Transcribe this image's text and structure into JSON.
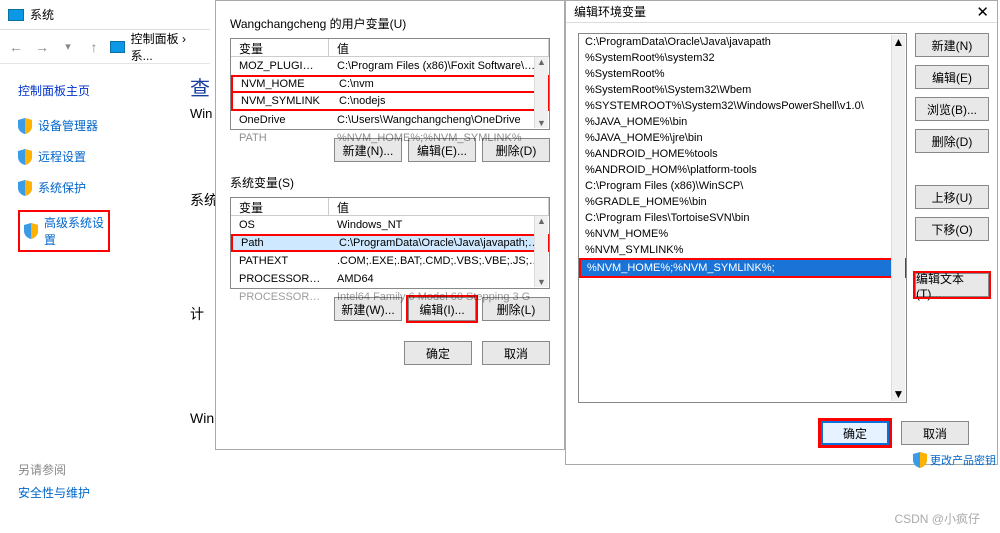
{
  "system_window": {
    "title": "系统",
    "breadcrumbs": [
      "控制面板",
      "系..."
    ],
    "cp_home": "控制面板主页",
    "side_items": [
      "设备管理器",
      "远程设置",
      "系统保护",
      "高级系统设置"
    ],
    "see_also_label": "另请参阅",
    "see_also_items": [
      "安全性与维护"
    ]
  },
  "mid": {
    "cha": "查",
    "win1": "Win",
    "sys": "系统",
    "ji": "计",
    "win2": "Win"
  },
  "env_dialog": {
    "user_vars_label": "Wangchangcheng 的用户变量(U)",
    "system_vars_label": "系统变量(S)",
    "headers": {
      "var": "变量",
      "val": "值"
    },
    "user_vars": [
      {
        "name": "MOZ_PLUGIN_PA...",
        "value": "C:\\Program Files (x86)\\Foxit Software\\Fo..."
      },
      {
        "name": "NVM_HOME",
        "value": "C:\\nvm"
      },
      {
        "name": "NVM_SYMLINK",
        "value": "C:\\nodejs"
      },
      {
        "name": "OneDrive",
        "value": "C:\\Users\\Wangchangcheng\\OneDrive"
      },
      {
        "name": "PATH",
        "value": "%NVM_HOME%;%NVM_SYMLINK%"
      }
    ],
    "system_vars": [
      {
        "name": "OS",
        "value": "Windows_NT"
      },
      {
        "name": "Path",
        "value": "C:\\ProgramData\\Oracle\\Java\\javapath;C:..."
      },
      {
        "name": "PATHEXT",
        "value": ".COM;.EXE;.BAT;.CMD;.VBS;.VBE;.JS;.JSE;..."
      },
      {
        "name": "PROCESSOR_AR...",
        "value": "AMD64"
      },
      {
        "name": "PROCESSOR_IDE",
        "value": "Intel64 Family 6 Model 60 Stepping 3 G"
      }
    ],
    "buttons": {
      "new_user": "新建(N)...",
      "edit_user": "编辑(E)...",
      "delete_user": "删除(D)",
      "new_sys": "新建(W)...",
      "edit_sys": "编辑(I)...",
      "delete_sys": "删除(L)",
      "ok": "确定",
      "cancel": "取消"
    }
  },
  "path_dialog": {
    "title": "编辑环境变量",
    "items": [
      "C:\\ProgramData\\Oracle\\Java\\javapath",
      "%SystemRoot%\\system32",
      "%SystemRoot%",
      "%SystemRoot%\\System32\\Wbem",
      "%SYSTEMROOT%\\System32\\WindowsPowerShell\\v1.0\\",
      "%JAVA_HOME%\\bin",
      "%JAVA_HOME%\\jre\\bin",
      "%ANDROID_HOME%tools",
      "%ANDROID_HOM%\\platform-tools",
      "C:\\Program Files (x86)\\WinSCP\\",
      "%GRADLE_HOME%\\bin",
      "C:\\Program Files\\TortoiseSVN\\bin",
      "%NVM_HOME%",
      "%NVM_SYMLINK%",
      "%NVM_HOME%;%NVM_SYMLINK%;"
    ],
    "buttons": {
      "new": "新建(N)",
      "edit": "编辑(E)",
      "browse": "浏览(B)...",
      "delete": "删除(D)",
      "moveup": "上移(U)",
      "movedown": "下移(O)",
      "edittext": "编辑文本(T)...",
      "ok": "确定",
      "cancel": "取消"
    },
    "keychange": "更改产品密钥"
  },
  "watermark": "CSDN @小疯仔"
}
